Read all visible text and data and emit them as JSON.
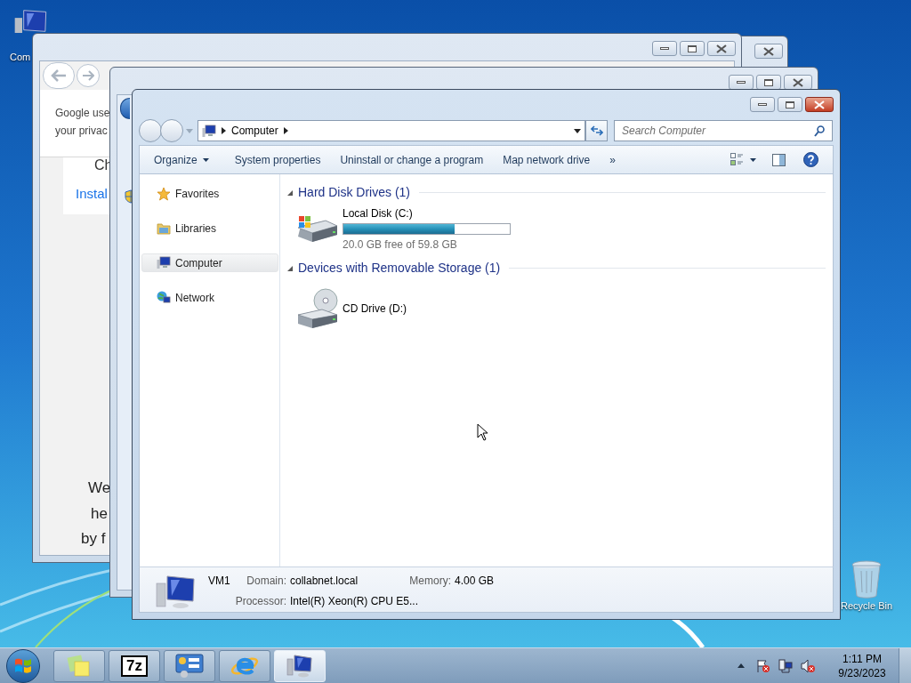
{
  "desktop": {
    "icons": [
      {
        "kind": "computer",
        "label": "Com"
      },
      {
        "kind": "recycle",
        "label": "Recycle Bin"
      }
    ]
  },
  "background_windows": [
    {
      "kind": "blank"
    },
    {
      "kind": "browser",
      "banner_lines": [
        "Google use",
        "your privac"
      ],
      "heading": "Ch",
      "link": "Instal",
      "footer_lines": [
        "We",
        "he",
        "by f"
      ]
    },
    {
      "kind": "explorer"
    }
  ],
  "window": {
    "address": {
      "crumbs": [
        "Computer"
      ]
    },
    "search": {
      "placeholder": "Search Computer"
    },
    "toolbar": [
      {
        "kind": "menu",
        "label": "Organize"
      },
      {
        "kind": "button",
        "label": "System properties"
      },
      {
        "kind": "button",
        "label": "Uninstall or change a program"
      },
      {
        "kind": "button",
        "label": "Map network drive"
      },
      {
        "kind": "overflow",
        "label": "»"
      }
    ],
    "nav": [
      {
        "kind": "star",
        "label": "Favorites",
        "selected": false
      },
      {
        "kind": "library",
        "label": "Libraries",
        "selected": false
      },
      {
        "kind": "computer",
        "label": "Computer",
        "selected": true
      },
      {
        "kind": "network",
        "label": "Network",
        "selected": false
      }
    ],
    "groups": [
      {
        "title": "Hard Disk Drives (1)",
        "items": [
          {
            "kind": "disk",
            "name": "Local Disk (C:)",
            "level": 0.666,
            "free": "20.0 GB free of 59.8 GB"
          }
        ]
      },
      {
        "title": "Devices with Removable Storage (1)",
        "items": [
          {
            "kind": "cd",
            "name": "CD Drive (D:)"
          }
        ]
      }
    ],
    "details": {
      "name": "VM1",
      "fields": [
        {
          "label": "Domain:",
          "value": "collabnet.local"
        },
        {
          "label": "Memory:",
          "value": "4.00 GB"
        },
        {
          "label": "Processor:",
          "value": "Intel(R) Xeon(R) CPU E5..."
        }
      ]
    }
  },
  "taskbar": {
    "items": [
      {
        "kind": "notes",
        "selected": false
      },
      {
        "kind": "sevenzip",
        "text": "7z",
        "selected": false
      },
      {
        "kind": "control",
        "selected": false
      },
      {
        "kind": "ie",
        "selected": false
      },
      {
        "kind": "computer",
        "selected": true
      }
    ],
    "time": "1:11 PM",
    "date": "9/23/2023"
  }
}
